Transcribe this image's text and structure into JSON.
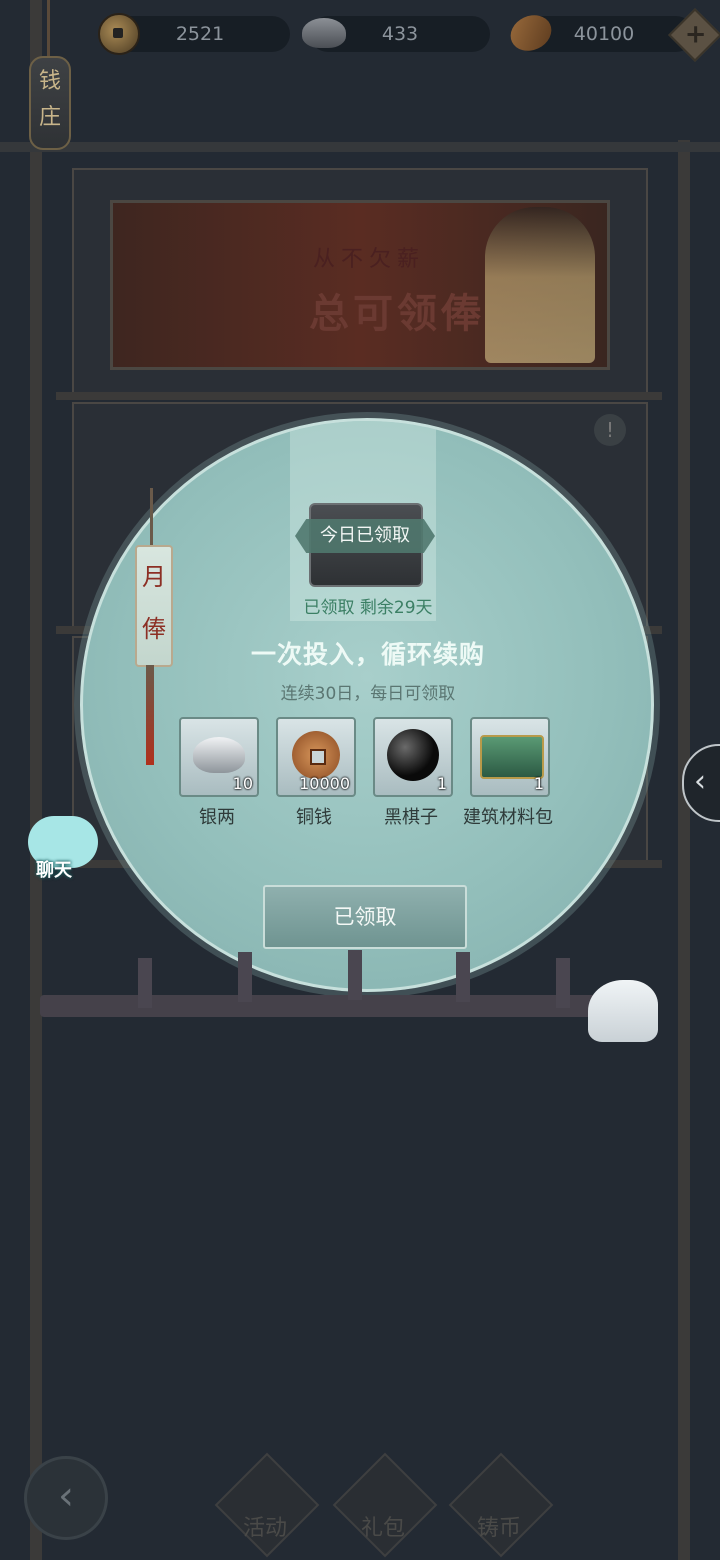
{
  "top_bar": {
    "coins": "2521",
    "silver": "433",
    "seeds": "40100",
    "add_label": "+"
  },
  "shop_lantern": "钱庄",
  "banner": {
    "sub": "从不欠薪",
    "title": "总可领俸"
  },
  "side_tag": "月俸",
  "modal": {
    "claimed_tag": "今日已领取",
    "status": "已领取  剩余29天",
    "headline": "一次投入，循环续购",
    "subline": "连续30日，每日可领取",
    "items": [
      {
        "name": "银两",
        "count": "10"
      },
      {
        "name": "铜钱",
        "count": "10000"
      },
      {
        "name": "黑棋子",
        "count": "1"
      },
      {
        "name": "建筑材料包",
        "count": "1"
      }
    ],
    "button": "已领取"
  },
  "chat": "聊天",
  "side_arrow": "‹",
  "bottom_tabs": [
    {
      "label": "活动"
    },
    {
      "label": "礼包"
    },
    {
      "label": "铸币"
    }
  ],
  "back": "‹",
  "colors": {
    "background": "#232a33",
    "modal": "#93bfbb",
    "accent_green": "#3b7f64",
    "tassel_red": "#8c2f24"
  }
}
